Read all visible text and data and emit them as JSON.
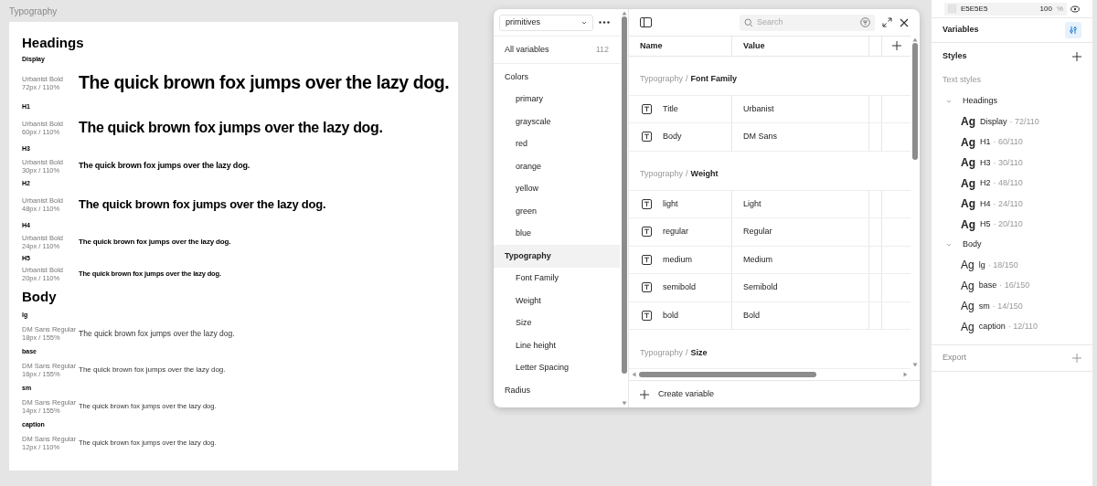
{
  "canvas": {
    "frame_title": "Typography",
    "sections": [
      {
        "title": "Headings",
        "kind": "heading",
        "styles": [
          {
            "name": "Display",
            "font": "Urbanist Bold",
            "metrics": "72px / 110%",
            "sample": "The quick brown fox jumps over the lazy dog."
          },
          {
            "name": "H1",
            "font": "Urbanist Bold",
            "metrics": "60px / 110%",
            "sample": "The quick brown fox jumps over the lazy dog."
          },
          {
            "name": "H3",
            "font": "Urbanist Bold",
            "metrics": "30px / 110%",
            "sample": "The quick brown fox jumps over the lazy dog."
          },
          {
            "name": "H2",
            "font": "Urbanist Bold",
            "metrics": "48px / 110%",
            "sample": "The quick brown fox jumps over the lazy dog."
          },
          {
            "name": "H4",
            "font": "Urbanist Bold",
            "metrics": "24px / 110%",
            "sample": "The quick brown fox jumps over the lazy dog."
          },
          {
            "name": "H5",
            "font": "Urbanist Bold",
            "metrics": "20px / 110%",
            "sample": "The quick brown fox jumps over the lazy dog."
          }
        ]
      },
      {
        "title": "Body",
        "kind": "body",
        "styles": [
          {
            "name": "lg",
            "font": "DM Sans Regular",
            "metrics": "18px / 155%",
            "sample": "The quick brown fox jumps over the lazy dog."
          },
          {
            "name": "base",
            "font": "DM Sans Regular",
            "metrics": "16px / 155%",
            "sample": "The quick brown fox jumps over the lazy dog."
          },
          {
            "name": "sm",
            "font": "DM Sans Regular",
            "metrics": "14px / 155%",
            "sample": "The quick brown fox jumps over the lazy dog."
          },
          {
            "name": "caption",
            "font": "DM Sans Regular",
            "metrics": "12px / 110%",
            "sample": "The quick brown fox jumps over the lazy dog."
          }
        ]
      }
    ]
  },
  "variables_panel": {
    "collection": "primitives",
    "all_variables": {
      "label": "All variables",
      "count": "112"
    },
    "groups": [
      {
        "label": "Colors",
        "selected": false,
        "children": [
          {
            "label": "primary",
            "selected": false
          },
          {
            "label": "grayscale",
            "selected": false
          },
          {
            "label": "red",
            "selected": false
          },
          {
            "label": "orange",
            "selected": false
          },
          {
            "label": "yellow",
            "selected": false
          },
          {
            "label": "green",
            "selected": false
          },
          {
            "label": "blue",
            "selected": false
          }
        ]
      },
      {
        "label": "Typography",
        "selected": true,
        "children": [
          {
            "label": "Font Family",
            "selected": false
          },
          {
            "label": "Weight",
            "selected": false
          },
          {
            "label": "Size",
            "selected": false
          },
          {
            "label": "Line height",
            "selected": false
          },
          {
            "label": "Letter Spacing",
            "selected": false
          }
        ]
      },
      {
        "label": "Radius",
        "selected": false
      }
    ],
    "search": {
      "placeholder": "Search"
    },
    "columns": [
      "Name",
      "Value"
    ],
    "table_groups": [
      {
        "path": "Typography",
        "separator": "/",
        "name": "Font Family",
        "rows": [
          {
            "name": "Title",
            "value": "Urbanist"
          },
          {
            "name": "Body",
            "value": "DM Sans"
          }
        ]
      },
      {
        "path": "Typography",
        "separator": "/",
        "name": "Weight",
        "rows": [
          {
            "name": "light",
            "value": "Light"
          },
          {
            "name": "regular",
            "value": "Regular"
          },
          {
            "name": "medium",
            "value": "Medium"
          },
          {
            "name": "semibold",
            "value": "Semibold"
          },
          {
            "name": "bold",
            "value": "Bold"
          }
        ]
      },
      {
        "path": "Typography",
        "separator": "/",
        "name": "Size"
      }
    ],
    "create_label": "Create variable"
  },
  "right_panel": {
    "fill": {
      "hex": "E5E5E5",
      "opacity": "100",
      "unit": "%"
    },
    "variables_label": "Variables",
    "styles_label": "Styles",
    "text_styles_label": "Text styles",
    "style_groups": [
      {
        "label": "Headings",
        "kind": "heading",
        "expanded": true,
        "items": [
          {
            "glyph": "Ag",
            "name": "Display",
            "spec": "· 72/110"
          },
          {
            "glyph": "Ag",
            "name": "H1",
            "spec": "· 60/110"
          },
          {
            "glyph": "Ag",
            "name": "H3",
            "spec": "· 30/110"
          },
          {
            "glyph": "Ag",
            "name": "H2",
            "spec": "· 48/110"
          },
          {
            "glyph": "Ag",
            "name": "H4",
            "spec": "· 24/110"
          },
          {
            "glyph": "Ag",
            "name": "H5",
            "spec": "· 20/110"
          }
        ]
      },
      {
        "label": "Body",
        "kind": "body",
        "expanded": true,
        "items": [
          {
            "glyph": "Ag",
            "name": "lg",
            "spec": "· 18/150"
          },
          {
            "glyph": "Ag",
            "name": "base",
            "spec": "· 16/150"
          },
          {
            "glyph": "Ag",
            "name": "sm",
            "spec": "· 14/150"
          },
          {
            "glyph": "Ag",
            "name": "caption",
            "spec": "· 12/110"
          }
        ]
      }
    ],
    "export_label": "Export"
  }
}
